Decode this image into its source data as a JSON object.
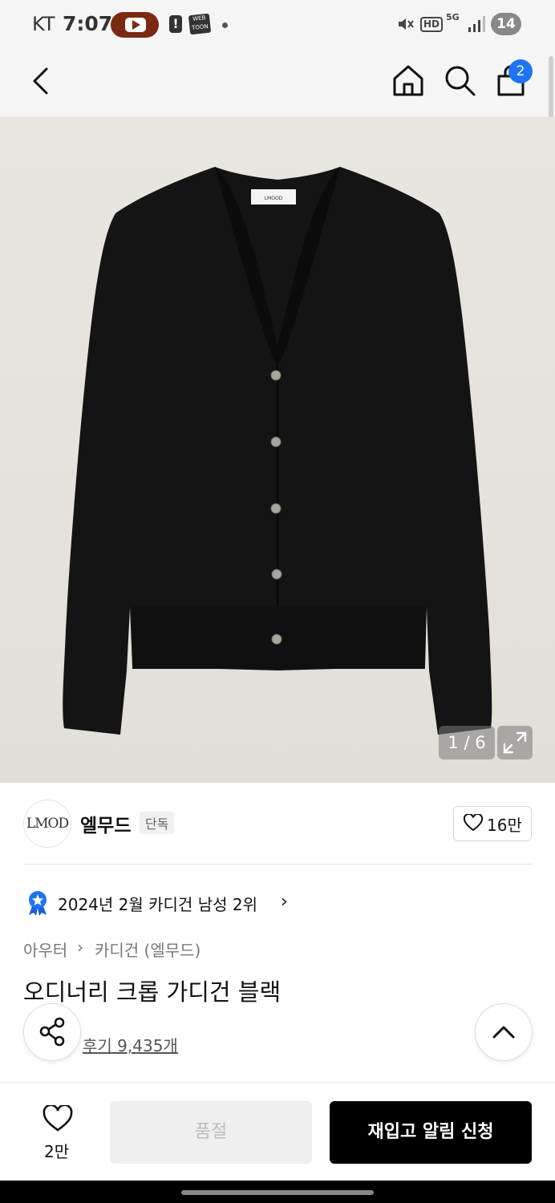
{
  "status_bar": {
    "carrier": "KT",
    "time": "7:07",
    "webtoon_label": "WEB TOON",
    "hd": "HD",
    "network": "5G",
    "battery": "14"
  },
  "header": {
    "back_icon": "chevron-left-icon",
    "home_icon": "home-icon",
    "search_icon": "search-icon",
    "cart_icon": "shopping-bag-icon",
    "cart_count": "2"
  },
  "gallery": {
    "counter": "1 / 6",
    "expand_icon": "expand-icon",
    "logo_label": "LMOOD"
  },
  "brand": {
    "logo_text": "LMOD",
    "name": "엘무드",
    "tag": "단독",
    "like_count": "16만"
  },
  "ranking": {
    "text": "2024년 2월 카디건 남성 2위",
    "chevron": "›"
  },
  "breadcrumb": {
    "category": "아우터",
    "separator": "›",
    "subcategory": "카디건 (엘무드)"
  },
  "product": {
    "title": "오디너리 크롭 가디건 블랙",
    "review_link": "후기 9,435개"
  },
  "bottom_bar": {
    "wish_count": "2만",
    "soldout_label": "품절",
    "restock_label": "재입고 알림 신청"
  },
  "colors": {
    "accent": "#1e74f5",
    "product": "#141414",
    "background": "#e8e5df"
  }
}
